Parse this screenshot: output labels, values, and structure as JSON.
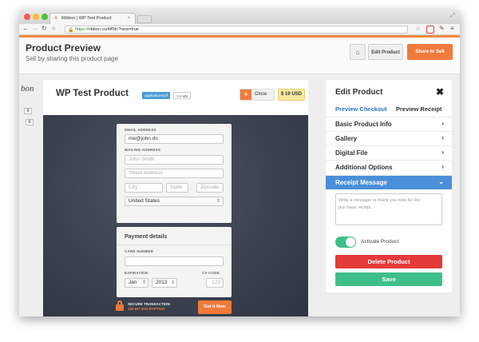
{
  "browser": {
    "tab_title": "Ribbon | WP Test Product",
    "tab_close": "×",
    "url_secure": "https://",
    "url_rest": "ribbon.co/4ff9fc?new=true"
  },
  "header": {
    "title": "Product Preview",
    "subtitle": "Sell by sharing this product page",
    "home_icon": "home-icon",
    "edit_product_label": "Edit Product",
    "share_label": "Share to Sell"
  },
  "left_strip": {
    "logo_fragment": "bon",
    "count1": "0",
    "count2": "0"
  },
  "product": {
    "title": "WP Test Product",
    "file_type": "application/pdf",
    "file_size": "3.5 MB",
    "close_label": "Close",
    "price": "$ 19 USD"
  },
  "checkout": {
    "email_label": "EMAIL ADDRESS",
    "email_value": "me@john.do",
    "mailing_label": "MAILING ADDRESS",
    "name_placeholder": "John Smith",
    "street_placeholder": "Street Address",
    "city_placeholder": "City",
    "state_placeholder": "State",
    "zip_placeholder": "Zipcode",
    "country": "United States",
    "payment_title": "Payment details",
    "card_label": "CARD NUMBER",
    "expiration_label": "EXPIRATION",
    "cvc_label": "CV CODE",
    "exp_month": "Jan",
    "exp_year": "2013",
    "cvc_placeholder": "123",
    "secure_line1": "SECURE TRANSACTION",
    "secure_line2": "128 BIT ENCRYPTION",
    "get_it_now": "Get It Now"
  },
  "sidebar": {
    "title": "Edit Product",
    "close_icon": "close-icon",
    "preview_checkout": "Preview Checkout",
    "preview_receipt": "Preview Receipt",
    "items": [
      {
        "label": "Basic Product Info",
        "chevron": "›"
      },
      {
        "label": "Gallery",
        "chevron": "›"
      },
      {
        "label": "Digital File",
        "chevron": "›"
      },
      {
        "label": "Additional Options",
        "chevron": "›"
      },
      {
        "label": "Receipt Message",
        "chevron": "⌄"
      }
    ],
    "receipt_placeholder": "Write a message or thank you note for the purchase receipt.",
    "activate_label": "Activate Product",
    "delete_label": "Delete Product",
    "save_label": "Save"
  },
  "colors": {
    "accent_orange": "#f07a3a",
    "active_blue": "#4a8fd8",
    "delete_red": "#e43a3a",
    "save_green": "#3ebf8a",
    "price_yellow": "#f7e9a0"
  }
}
